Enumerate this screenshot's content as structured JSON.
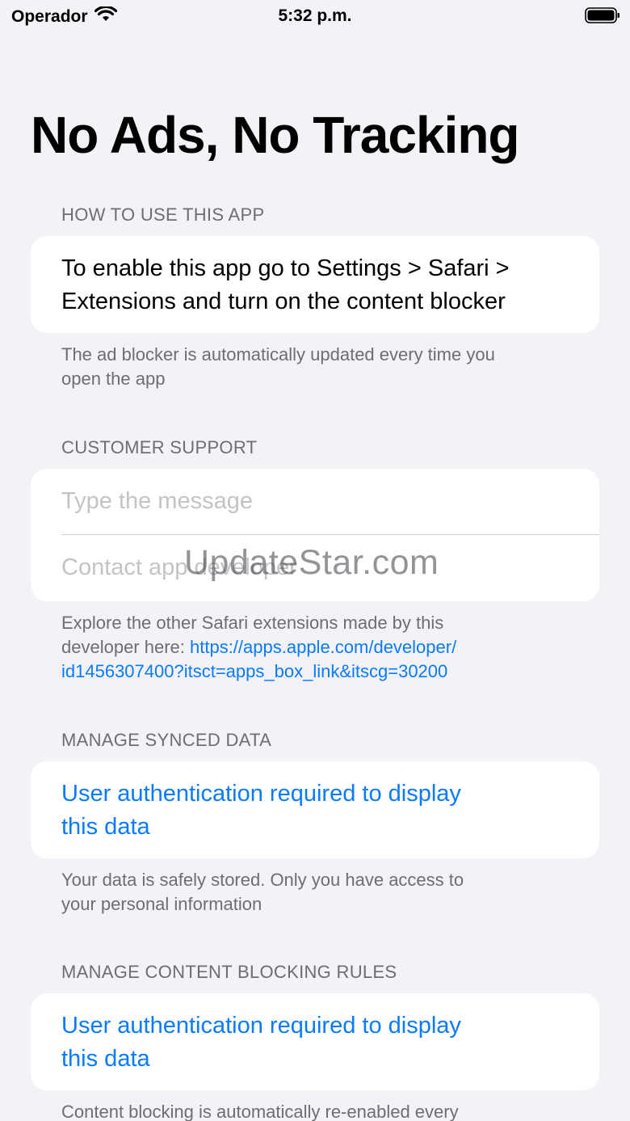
{
  "status_bar": {
    "carrier": "Operador",
    "time": "5:32 p.m.",
    "wifi_icon": "wifi-icon",
    "battery_icon": "battery-icon"
  },
  "page": {
    "title": "No Ads, No Tracking"
  },
  "sections": {
    "how_to": {
      "header": "HOW TO USE THIS APP",
      "body_line1": "To enable this app go to Settings > Safari >",
      "body_line2": "Extensions and turn on the content blocker",
      "footer_line1": "The ad blocker is automatically updated every time you",
      "footer_line2": "open the app"
    },
    "support": {
      "header": "CUSTOMER SUPPORT",
      "message_placeholder": "Type the message",
      "contact_label": "Contact app developer",
      "footer_line1": "Explore the other Safari extensions made by this",
      "footer_line2_prefix": "developer here: ",
      "link_part1": "https://apps.apple.com/developer/",
      "link_part2": "id1456307400?itsct=apps_box_link&itscg=30200"
    },
    "synced": {
      "header": "MANAGE SYNCED DATA",
      "auth_line1": "User authentication required to display",
      "auth_line2": "this data",
      "footer_line1": "Your data is safely stored. Only you have access to",
      "footer_line2": "your personal information"
    },
    "rules": {
      "header": "MANAGE CONTENT BLOCKING RULES",
      "auth_line1": "User authentication required to display",
      "auth_line2": "this data",
      "footer_line1": "Content blocking is automatically re-enabled every"
    }
  },
  "watermark": "UpdateStar.com",
  "colors": {
    "background": "#f2f2f7",
    "accent": "#0a7aff",
    "secondary_text": "#6d6d72"
  }
}
